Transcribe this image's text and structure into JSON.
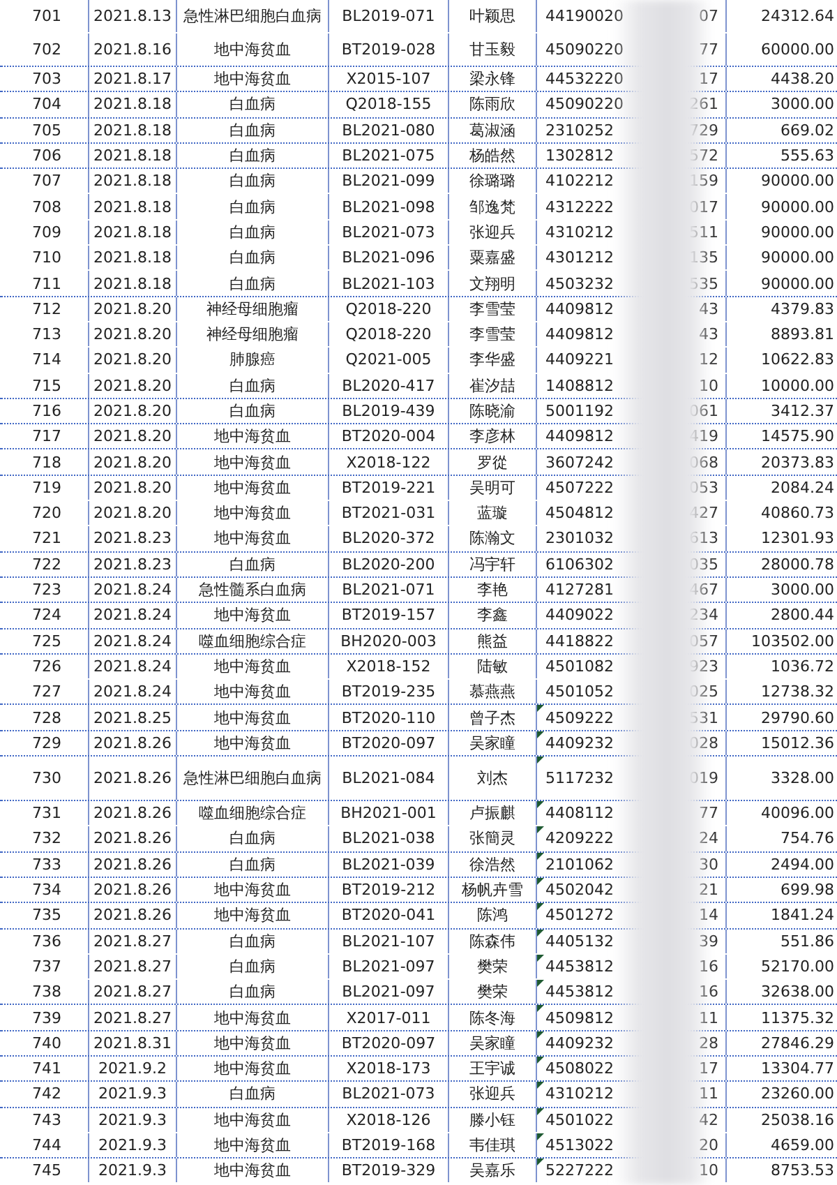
{
  "rows": [
    {
      "no": "701",
      "date": "2021.8.13",
      "disease": "急性淋巴细胞白血病",
      "code": "BL2019-071",
      "name": "叶颖思",
      "id_start": "44190020",
      "id_end": "07",
      "amount": "24312.64",
      "border_below": false,
      "comment": false
    },
    {
      "no": "702",
      "date": "2021.8.16",
      "disease": "地中海贫血",
      "code": "BT2019-028",
      "name": "甘玉毅",
      "id_start": "45090220",
      "id_end": "77",
      "amount": "60000.00",
      "border_below": true,
      "comment": false
    },
    {
      "no": "703",
      "date": "2021.8.17",
      "disease": "地中海贫血",
      "code": "X2015-107",
      "name": "梁永锋",
      "id_start": "44532220",
      "id_end": "17",
      "amount": "4438.20",
      "border_below": true,
      "comment": false
    },
    {
      "no": "704",
      "date": "2021.8.18",
      "disease": "白血病",
      "code": "Q2018-155",
      "name": "陈雨欣",
      "id_start": "45090220",
      "id_end": "261",
      "amount": "3000.00",
      "border_below": true,
      "comment": false
    },
    {
      "no": "705",
      "date": "2021.8.18",
      "disease": "白血病",
      "code": "BL2021-080",
      "name": "葛淑涵",
      "id_start": "2310252",
      "id_end": "729",
      "amount": "669.02",
      "border_below": true,
      "comment": false
    },
    {
      "no": "706",
      "date": "2021.8.18",
      "disease": "白血病",
      "code": "BL2021-075",
      "name": "杨皓然",
      "id_start": "1302812",
      "id_end": "572",
      "amount": "555.63",
      "border_below": true,
      "comment": false
    },
    {
      "no": "707",
      "date": "2021.8.18",
      "disease": "白血病",
      "code": "BL2021-099",
      "name": "徐璐璐",
      "id_start": "4102212",
      "id_end": "159",
      "amount": "90000.00",
      "border_below": false,
      "comment": false
    },
    {
      "no": "708",
      "date": "2021.8.18",
      "disease": "白血病",
      "code": "BL2021-098",
      "name": "邹逸梵",
      "id_start": "4312222",
      "id_end": "017",
      "amount": "90000.00",
      "border_below": false,
      "comment": false
    },
    {
      "no": "709",
      "date": "2021.8.18",
      "disease": "白血病",
      "code": "BL2021-073",
      "name": "张迎兵",
      "id_start": "4310212",
      "id_end": "511",
      "amount": "90000.00",
      "border_below": false,
      "comment": false
    },
    {
      "no": "710",
      "date": "2021.8.18",
      "disease": "白血病",
      "code": "BL2021-096",
      "name": "粟嘉盛",
      "id_start": "4301212",
      "id_end": "135",
      "amount": "90000.00",
      "border_below": false,
      "comment": false
    },
    {
      "no": "711",
      "date": "2021.8.18",
      "disease": "白血病",
      "code": "BL2021-103",
      "name": "文翔明",
      "id_start": "4503232",
      "id_end": "535",
      "amount": "90000.00",
      "border_below": true,
      "comment": false
    },
    {
      "no": "712",
      "date": "2021.8.20",
      "disease": "神经母细胞瘤",
      "code": "Q2018-220",
      "name": "李雪莹",
      "id_start": "4409812",
      "id_end": "43",
      "amount": "4379.83",
      "border_below": false,
      "comment": false
    },
    {
      "no": "713",
      "date": "2021.8.20",
      "disease": "神经母细胞瘤",
      "code": "Q2018-220",
      "name": "李雪莹",
      "id_start": "4409812",
      "id_end": "43",
      "amount": "8893.81",
      "border_below": false,
      "comment": false
    },
    {
      "no": "714",
      "date": "2021.8.20",
      "disease": "肺腺癌",
      "code": "Q2021-005",
      "name": "李华盛",
      "id_start": "4409221",
      "id_end": "12",
      "amount": "10622.83",
      "border_below": false,
      "comment": false
    },
    {
      "no": "715",
      "date": "2021.8.20",
      "disease": "白血病",
      "code": "BL2020-417",
      "name": "崔汐喆",
      "id_start": "1408812",
      "id_end": "10",
      "amount": "10000.00",
      "border_below": true,
      "comment": false
    },
    {
      "no": "716",
      "date": "2021.8.20",
      "disease": "白血病",
      "code": "BL2019-439",
      "name": "陈晓渝",
      "id_start": "5001192",
      "id_end": "061",
      "amount": "3412.37",
      "border_below": true,
      "comment": false
    },
    {
      "no": "717",
      "date": "2021.8.20",
      "disease": "地中海贫血",
      "code": "BT2020-004",
      "name": "李彦林",
      "id_start": "4409812",
      "id_end": "419",
      "amount": "14575.90",
      "border_below": true,
      "comment": false
    },
    {
      "no": "718",
      "date": "2021.8.20",
      "disease": "地中海贫血",
      "code": "X2018-122",
      "name": "罗從",
      "id_start": "3607242",
      "id_end": "068",
      "amount": "20373.83",
      "border_below": true,
      "comment": false
    },
    {
      "no": "719",
      "date": "2021.8.20",
      "disease": "地中海贫血",
      "code": "BT2019-221",
      "name": "吴明可",
      "id_start": "4507222",
      "id_end": "053",
      "amount": "2084.24",
      "border_below": false,
      "comment": false
    },
    {
      "no": "720",
      "date": "2021.8.20",
      "disease": "地中海贫血",
      "code": "BT2021-031",
      "name": "蓝璇",
      "id_start": "4504812",
      "id_end": "427",
      "amount": "40860.73",
      "border_below": false,
      "comment": false
    },
    {
      "no": "721",
      "date": "2021.8.23",
      "disease": "地中海贫血",
      "code": "BL2020-372",
      "name": "陈瀚文",
      "id_start": "2301032",
      "id_end": "613",
      "amount": "12301.93",
      "border_below": true,
      "comment": false
    },
    {
      "no": "722",
      "date": "2021.8.23",
      "disease": "白血病",
      "code": "BL2020-200",
      "name": "冯宇轩",
      "id_start": "6106302",
      "id_end": "035",
      "amount": "28000.78",
      "border_below": true,
      "comment": false
    },
    {
      "no": "723",
      "date": "2021.8.24",
      "disease": "急性髓系白血病",
      "code": "BL2021-071",
      "name": "李艳",
      "id_start": "4127281",
      "id_end": "467",
      "amount": "3000.00",
      "border_below": true,
      "comment": false
    },
    {
      "no": "724",
      "date": "2021.8.24",
      "disease": "地中海贫血",
      "code": "BT2019-157",
      "name": "李鑫",
      "id_start": "4409022",
      "id_end": "234",
      "amount": "2800.44",
      "border_below": true,
      "comment": false
    },
    {
      "no": "725",
      "date": "2021.8.24",
      "disease": "噬血细胞综合症",
      "code": "BH2020-003",
      "name": "熊益",
      "id_start": "4418822",
      "id_end": "057",
      "amount": "103502.00",
      "border_below": true,
      "comment": false
    },
    {
      "no": "726",
      "date": "2021.8.24",
      "disease": "地中海贫血",
      "code": "X2018-152",
      "name": "陆敏",
      "id_start": "4501082",
      "id_end": "923",
      "amount": "1036.72",
      "border_below": false,
      "comment": false
    },
    {
      "no": "727",
      "date": "2021.8.24",
      "disease": "地中海贫血",
      "code": "BT2019-235",
      "name": "慕燕燕",
      "id_start": "4501052",
      "id_end": "025",
      "amount": "12738.32",
      "border_below": true,
      "comment": false
    },
    {
      "no": "728",
      "date": "2021.8.25",
      "disease": "地中海贫血",
      "code": "BT2020-110",
      "name": "曾子杰",
      "id_start": "4509222",
      "id_end": "531",
      "amount": "29790.60",
      "border_below": true,
      "comment": true
    },
    {
      "no": "729",
      "date": "2021.8.26",
      "disease": "地中海贫血",
      "code": "BT2020-097",
      "name": "吴家瞳",
      "id_start": "4409232",
      "id_end": "028",
      "amount": "15012.36",
      "border_below": true,
      "comment": true
    },
    {
      "no": "730",
      "date": "2021.8.26",
      "disease": "急性淋巴细胞白血病",
      "code": "BL2021-084",
      "name": "刘杰",
      "id_start": "5117232",
      "id_end": "019",
      "amount": "3328.00",
      "border_below": true,
      "comment": true
    },
    {
      "no": "731",
      "date": "2021.8.26",
      "disease": "噬血细胞综合症",
      "code": "BH2021-001",
      "name": "卢振麒",
      "id_start": "4408112",
      "id_end": "77",
      "amount": "40096.00",
      "border_below": false,
      "comment": true
    },
    {
      "no": "732",
      "date": "2021.8.26",
      "disease": "白血病",
      "code": "BL2021-038",
      "name": "张簡灵",
      "id_start": "4209222",
      "id_end": "24",
      "amount": "754.76",
      "border_below": true,
      "comment": true
    },
    {
      "no": "733",
      "date": "2021.8.26",
      "disease": "白血病",
      "code": "BL2021-039",
      "name": "徐浩然",
      "id_start": "2101062",
      "id_end": "30",
      "amount": "2494.00",
      "border_below": true,
      "comment": true
    },
    {
      "no": "734",
      "date": "2021.8.26",
      "disease": "地中海贫血",
      "code": "BT2019-212",
      "name": "杨帆卉雪",
      "id_start": "4502042",
      "id_end": "21",
      "amount": "699.98",
      "border_below": true,
      "comment": true
    },
    {
      "no": "735",
      "date": "2021.8.26",
      "disease": "地中海贫血",
      "code": "BT2020-041",
      "name": "陈鸿",
      "id_start": "4501272",
      "id_end": "14",
      "amount": "1841.24",
      "border_below": true,
      "comment": true
    },
    {
      "no": "736",
      "date": "2021.8.27",
      "disease": "白血病",
      "code": "BL2021-107",
      "name": "陈森伟",
      "id_start": "4405132",
      "id_end": "39",
      "amount": "551.86",
      "border_below": false,
      "comment": true
    },
    {
      "no": "737",
      "date": "2021.8.27",
      "disease": "白血病",
      "code": "BL2021-097",
      "name": "樊荣",
      "id_start": "4453812",
      "id_end": "16",
      "amount": "52170.00",
      "border_below": false,
      "comment": true
    },
    {
      "no": "738",
      "date": "2021.8.27",
      "disease": "白血病",
      "code": "BL2021-097",
      "name": "樊荣",
      "id_start": "4453812",
      "id_end": "16",
      "amount": "32638.00",
      "border_below": true,
      "comment": true
    },
    {
      "no": "739",
      "date": "2021.8.27",
      "disease": "地中海贫血",
      "code": "X2017-011",
      "name": "陈冬海",
      "id_start": "4509812",
      "id_end": "11",
      "amount": "11375.32",
      "border_below": true,
      "comment": true
    },
    {
      "no": "740",
      "date": "2021.8.31",
      "disease": "地中海贫血",
      "code": "BT2020-097",
      "name": "吴家瞳",
      "id_start": "4409232",
      "id_end": "28",
      "amount": "27846.29",
      "border_below": true,
      "comment": true
    },
    {
      "no": "741",
      "date": "2021.9.2",
      "disease": "地中海贫血",
      "code": "X2018-173",
      "name": "王宇诚",
      "id_start": "4508022",
      "id_end": "17",
      "amount": "13304.77",
      "border_below": true,
      "comment": true
    },
    {
      "no": "742",
      "date": "2021.9.3",
      "disease": "白血病",
      "code": "BL2021-073",
      "name": "张迎兵",
      "id_start": "4310212",
      "id_end": "11",
      "amount": "23260.00",
      "border_below": true,
      "comment": true
    },
    {
      "no": "743",
      "date": "2021.9.3",
      "disease": "地中海贫血",
      "code": "X2018-126",
      "name": "滕小钰",
      "id_start": "4501022",
      "id_end": "42",
      "amount": "25038.16",
      "border_below": false,
      "comment": true
    },
    {
      "no": "744",
      "date": "2021.9.3",
      "disease": "地中海贫血",
      "code": "BT2019-168",
      "name": "韦佳琪",
      "id_start": "4513022",
      "id_end": "20",
      "amount": "4659.00",
      "border_below": true,
      "comment": true
    },
    {
      "no": "745",
      "date": "2021.9.3",
      "disease": "地中海贫血",
      "code": "BT2019-329",
      "name": "吴嘉乐",
      "id_start": "5227222",
      "id_end": "10",
      "amount": "8753.53",
      "border_below": false,
      "comment": true
    }
  ]
}
